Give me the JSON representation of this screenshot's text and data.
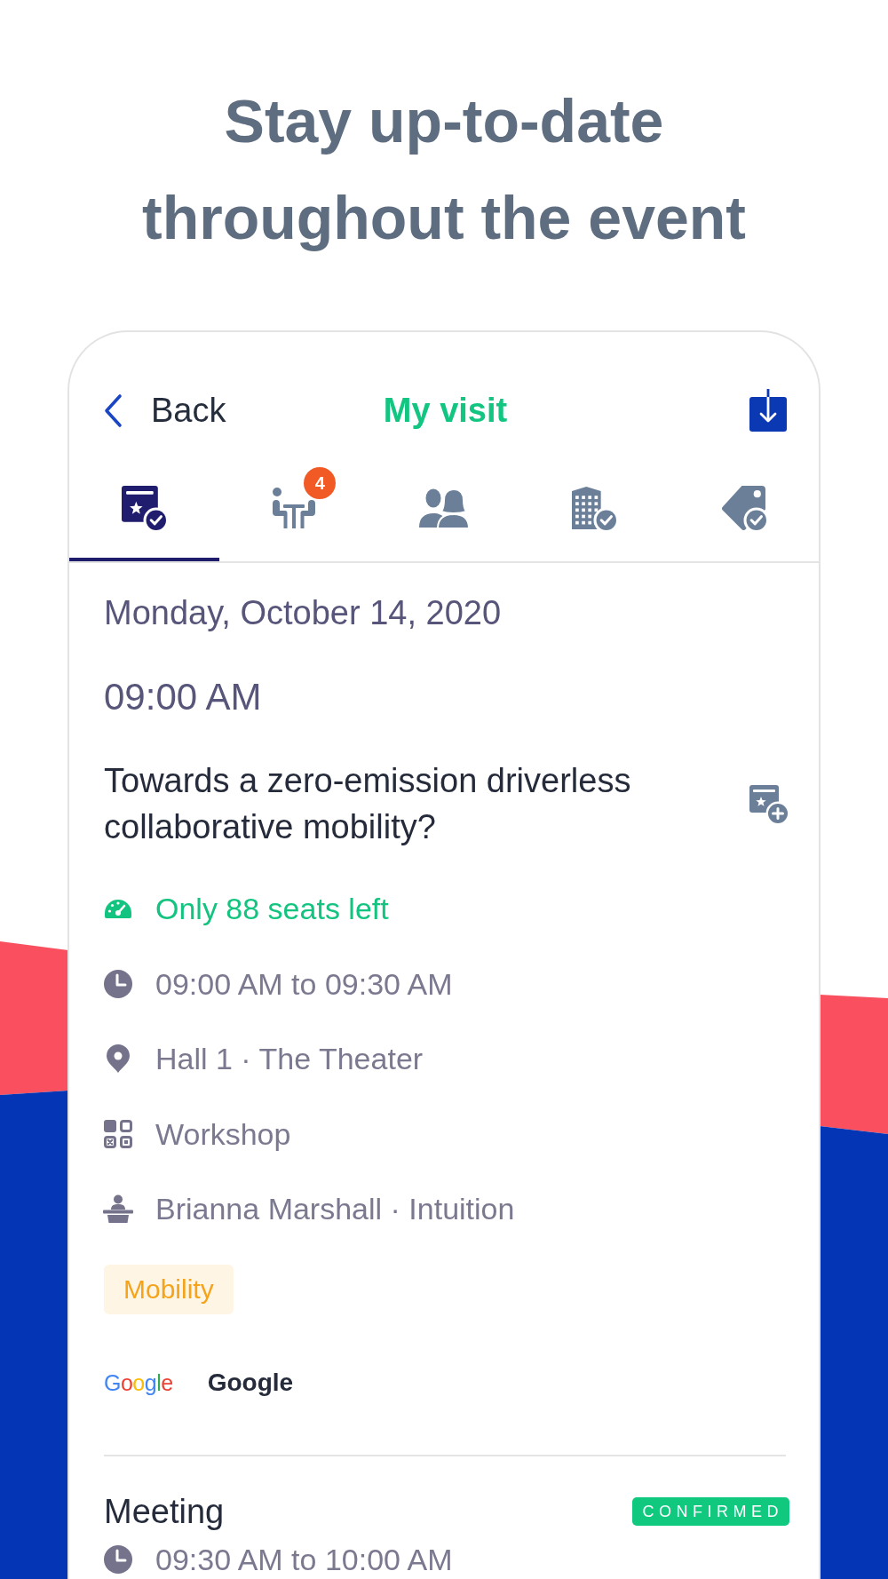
{
  "headline": "Stay up-to-date throughout the event",
  "header": {
    "back_label": "Back",
    "title": "My visit"
  },
  "tabs": [
    {
      "kind": "agenda",
      "selected": true
    },
    {
      "kind": "meetings",
      "selected": false,
      "badge": "4"
    },
    {
      "kind": "contacts",
      "selected": false
    },
    {
      "kind": "exhibitors",
      "selected": false
    },
    {
      "kind": "offers",
      "selected": false
    }
  ],
  "date": "Monday, October 14, 2020",
  "time": "09:00 AM",
  "entries": [
    {
      "kind": "session",
      "title": "Towards a zero-emission driverless collaborative mobility?",
      "details": [
        {
          "kind": "seats",
          "text": "Only 88 seats left"
        },
        {
          "kind": "time",
          "text": "09:00 AM to 09:30 AM"
        },
        {
          "kind": "location",
          "text": "Hall 1 · The Theater"
        },
        {
          "kind": "format",
          "text": "Workshop"
        },
        {
          "kind": "speaker",
          "text": "Brianna Marshall · Intuition"
        }
      ],
      "tags": [
        "Mobility"
      ],
      "sponsor": {
        "logo": "Google",
        "name": "Google"
      }
    },
    {
      "kind": "meeting",
      "title": "Meeting",
      "status": "CONFIRMED",
      "details": [
        {
          "kind": "time",
          "text": "09:30 AM to 10:00 AM"
        }
      ]
    }
  ]
}
